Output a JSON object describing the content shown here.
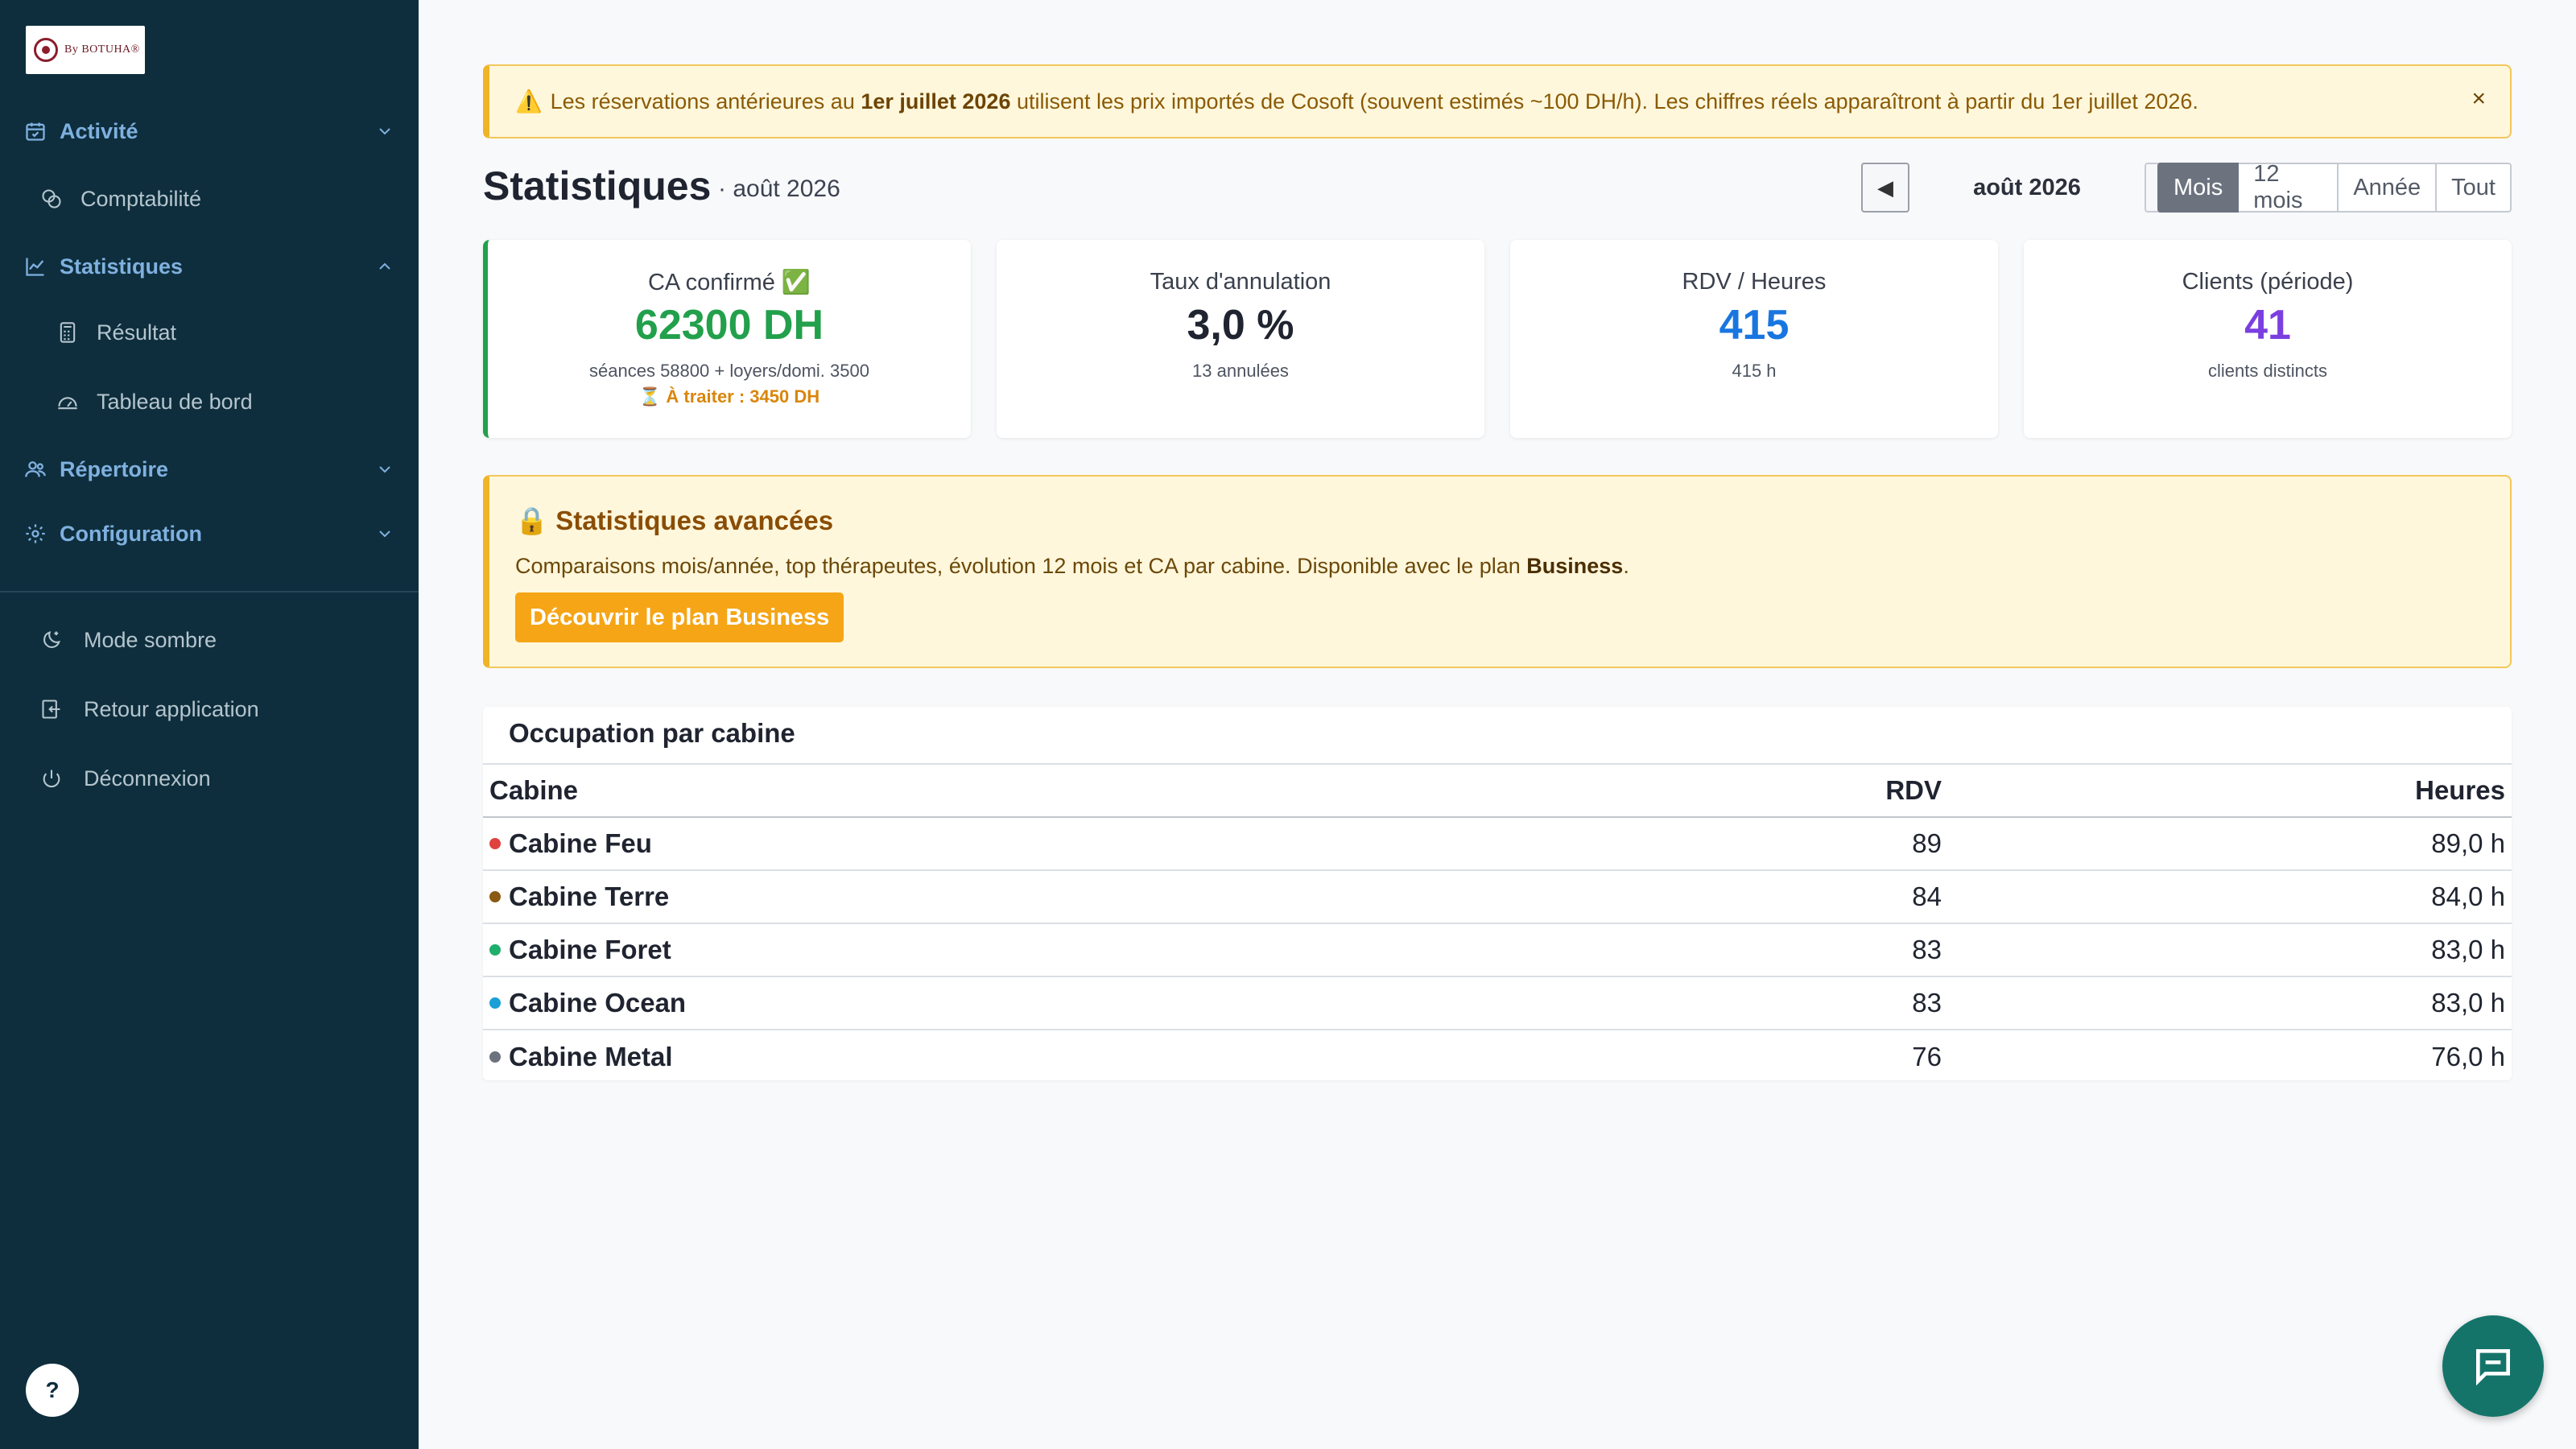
{
  "sidebar": {
    "logo_text": "By BOTUHA®",
    "items": [
      {
        "label": "Activité",
        "icon": "calendar-check-icon"
      },
      {
        "label": "Comptabilité",
        "icon": "coins-icon"
      },
      {
        "label": "Statistiques",
        "icon": "chart-line-icon"
      },
      {
        "label": "Résultat",
        "icon": "calculator-icon"
      },
      {
        "label": "Tableau de bord",
        "icon": "gauge-icon"
      },
      {
        "label": "Répertoire",
        "icon": "users-icon"
      },
      {
        "label": "Configuration",
        "icon": "gear-icon"
      }
    ],
    "footer": [
      {
        "label": "Mode sombre",
        "icon": "moon-icon"
      },
      {
        "label": "Retour application",
        "icon": "return-icon"
      },
      {
        "label": "Déconnexion",
        "icon": "power-icon"
      }
    ],
    "help_label": "?"
  },
  "banner": {
    "icon": "⚠️",
    "prefix": "Les réservations antérieures au ",
    "bold": "1er juillet 2026",
    "suffix": " utilisent les prix importés de Cosoft (souvent estimés ~100 DH/h). Les chiffres réels apparaîtront à partir du 1er juillet 2026.",
    "close": "×"
  },
  "header": {
    "title": "Statistiques",
    "subtitle": "· août 2026",
    "period": "août 2026",
    "prev": "◀",
    "next": "▶",
    "ranges": [
      "Mois",
      "12 mois",
      "Année",
      "Tout"
    ],
    "active_range": "Mois"
  },
  "kpis": [
    {
      "label": "CA confirmé ✅",
      "value": "62300 DH",
      "sub": "séances 58800 + loyers/domi. 3500",
      "sub2": "⏳ À traiter : 3450 DH",
      "color": "#22a04b"
    },
    {
      "label": "Taux d'annulation",
      "value": "3,0 %",
      "sub": "13 annulées",
      "color": "#1f2430"
    },
    {
      "label": "RDV / Heures",
      "value": "415",
      "sub": "415 h",
      "color": "#1976e0"
    },
    {
      "label": "Clients (période)",
      "value": "41",
      "sub": "clients distincts",
      "color": "#7b3fe0"
    }
  ],
  "upsell": {
    "title": "🔒 Statistiques avancées",
    "text": "Comparaisons mois/année, top thérapeutes, évolution 12 mois et CA par cabine. Disponible avec le plan ",
    "text_bold": "Business",
    "text_end": ".",
    "button": "Découvrir le plan Business"
  },
  "occupation": {
    "title": "Occupation par cabine",
    "columns": [
      "Cabine",
      "RDV",
      "Heures"
    ],
    "rows": [
      {
        "name": "Cabine Feu",
        "rdv": "89",
        "hours": "89,0 h",
        "color": "#e0413f"
      },
      {
        "name": "Cabine Terre",
        "rdv": "84",
        "hours": "84,0 h",
        "color": "#8b5a12"
      },
      {
        "name": "Cabine Foret",
        "rdv": "83",
        "hours": "83,0 h",
        "color": "#1fae6c"
      },
      {
        "name": "Cabine Ocean",
        "rdv": "83",
        "hours": "83,0 h",
        "color": "#1aa0d6"
      },
      {
        "name": "Cabine Metal",
        "rdv": "76",
        "hours": "76,0 h",
        "color": "#6c737f"
      }
    ]
  },
  "chat": {
    "icon": "chat-bubble-icon"
  }
}
